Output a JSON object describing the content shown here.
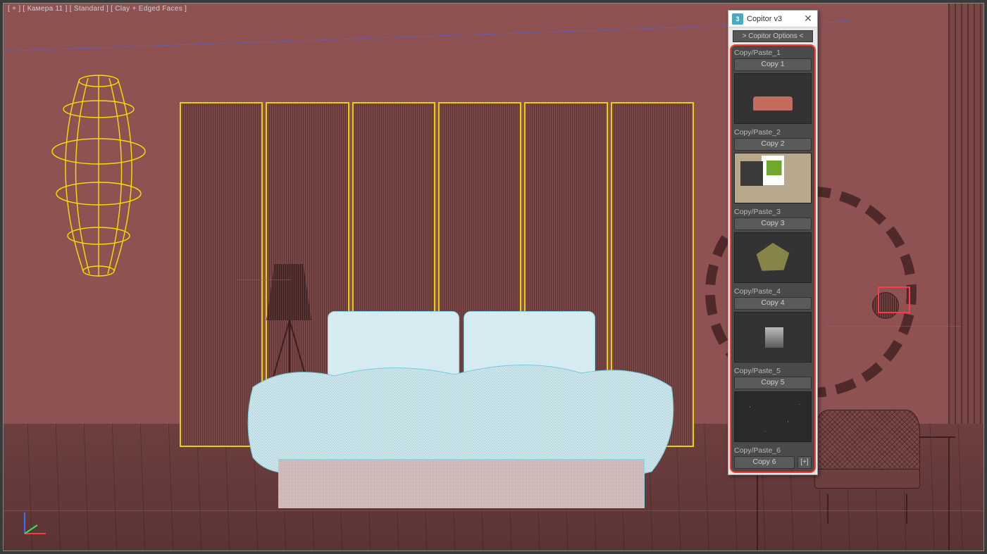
{
  "viewport": {
    "label": "[ + ] [ Камера 11 ] [ Standard ] [ Clay + Edged Faces ]"
  },
  "window": {
    "app_icon_label": "3",
    "title": "Copitor v3",
    "close_label": "✕",
    "options_label": "> Copitor Options <"
  },
  "slots": [
    {
      "label": "Copy/Paste_1",
      "button": "Copy 1"
    },
    {
      "label": "Copy/Paste_2",
      "button": "Copy 2"
    },
    {
      "label": "Copy/Paste_3",
      "button": "Copy 3"
    },
    {
      "label": "Copy/Paste_4",
      "button": "Copy 4"
    },
    {
      "label": "Copy/Paste_5",
      "button": "Copy 5"
    },
    {
      "label": "Copy/Paste_6",
      "button": "Copy 6",
      "plus": "[+]"
    }
  ]
}
